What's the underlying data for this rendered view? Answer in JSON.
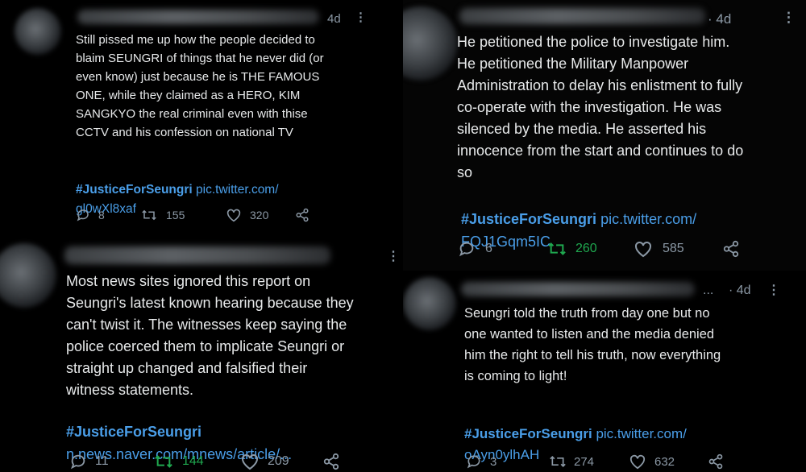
{
  "tweets": [
    {
      "time": "4d",
      "body": "Still pissed me up how the people decided to\nblaim SEUNGRI of things that he never did (or\neven know) just because he is THE FAMOUS\nONE, while they claimed as a HERO, KIM\nSANGKYO the real criminal even with thise\nCCTV and his confession on national TV",
      "hashtag": "#JusticeForSeungri",
      "link_line1": "pic.twitter.com/",
      "link_line2": "gl0wXl8xaf",
      "replies": "8",
      "retweets": "155",
      "likes": "320"
    },
    {
      "time": "· 4d",
      "body": "He petitioned the police to investigate him.\nHe petitioned the Military Manpower\nAdministration to delay his enlistment to fully\nco-operate with the investigation. He was\nsilenced by the media. He asserted his\ninnocence from the start and continues to do\nso",
      "hashtag": "#JusticeForSeungri",
      "link_line1": "pic.twitter.com/",
      "link_line2": "FQJ1Gqm5IC",
      "replies": "6",
      "retweets": "260",
      "likes": "585"
    },
    {
      "time": "",
      "body": "Most news sites ignored this report on\nSeungri's latest known hearing because they\ncan't twist it. The witnesses keep saying the\npolice coerced them to implicate Seungri or\nstraight up changed and falsified their\nwitness statements.",
      "hashtag": "#JusticeForSeungri",
      "link_line1": "n.news.naver.com/mnews/article/...",
      "link_line2": "",
      "replies": "11",
      "retweets": "144",
      "likes": "209"
    },
    {
      "time": "· 4d",
      "ellipsis": "...",
      "body": "Seungri told the truth from day one but no\none wanted to listen and the media denied\nhim the right to tell his truth, now everything\nis coming to light!",
      "hashtag": "#JusticeForSeungri",
      "link_line1": "pic.twitter.com/",
      "link_line2": "oAyn0ylhAH",
      "replies": "3",
      "retweets": "274",
      "likes": "632"
    }
  ],
  "colors": {
    "link": "#4a9ee8",
    "retweet_active": "#1fa84f",
    "muted": "#8b98a5"
  },
  "icons": [
    "reply-icon",
    "retweet-icon",
    "like-icon",
    "share-icon",
    "more-icon"
  ]
}
